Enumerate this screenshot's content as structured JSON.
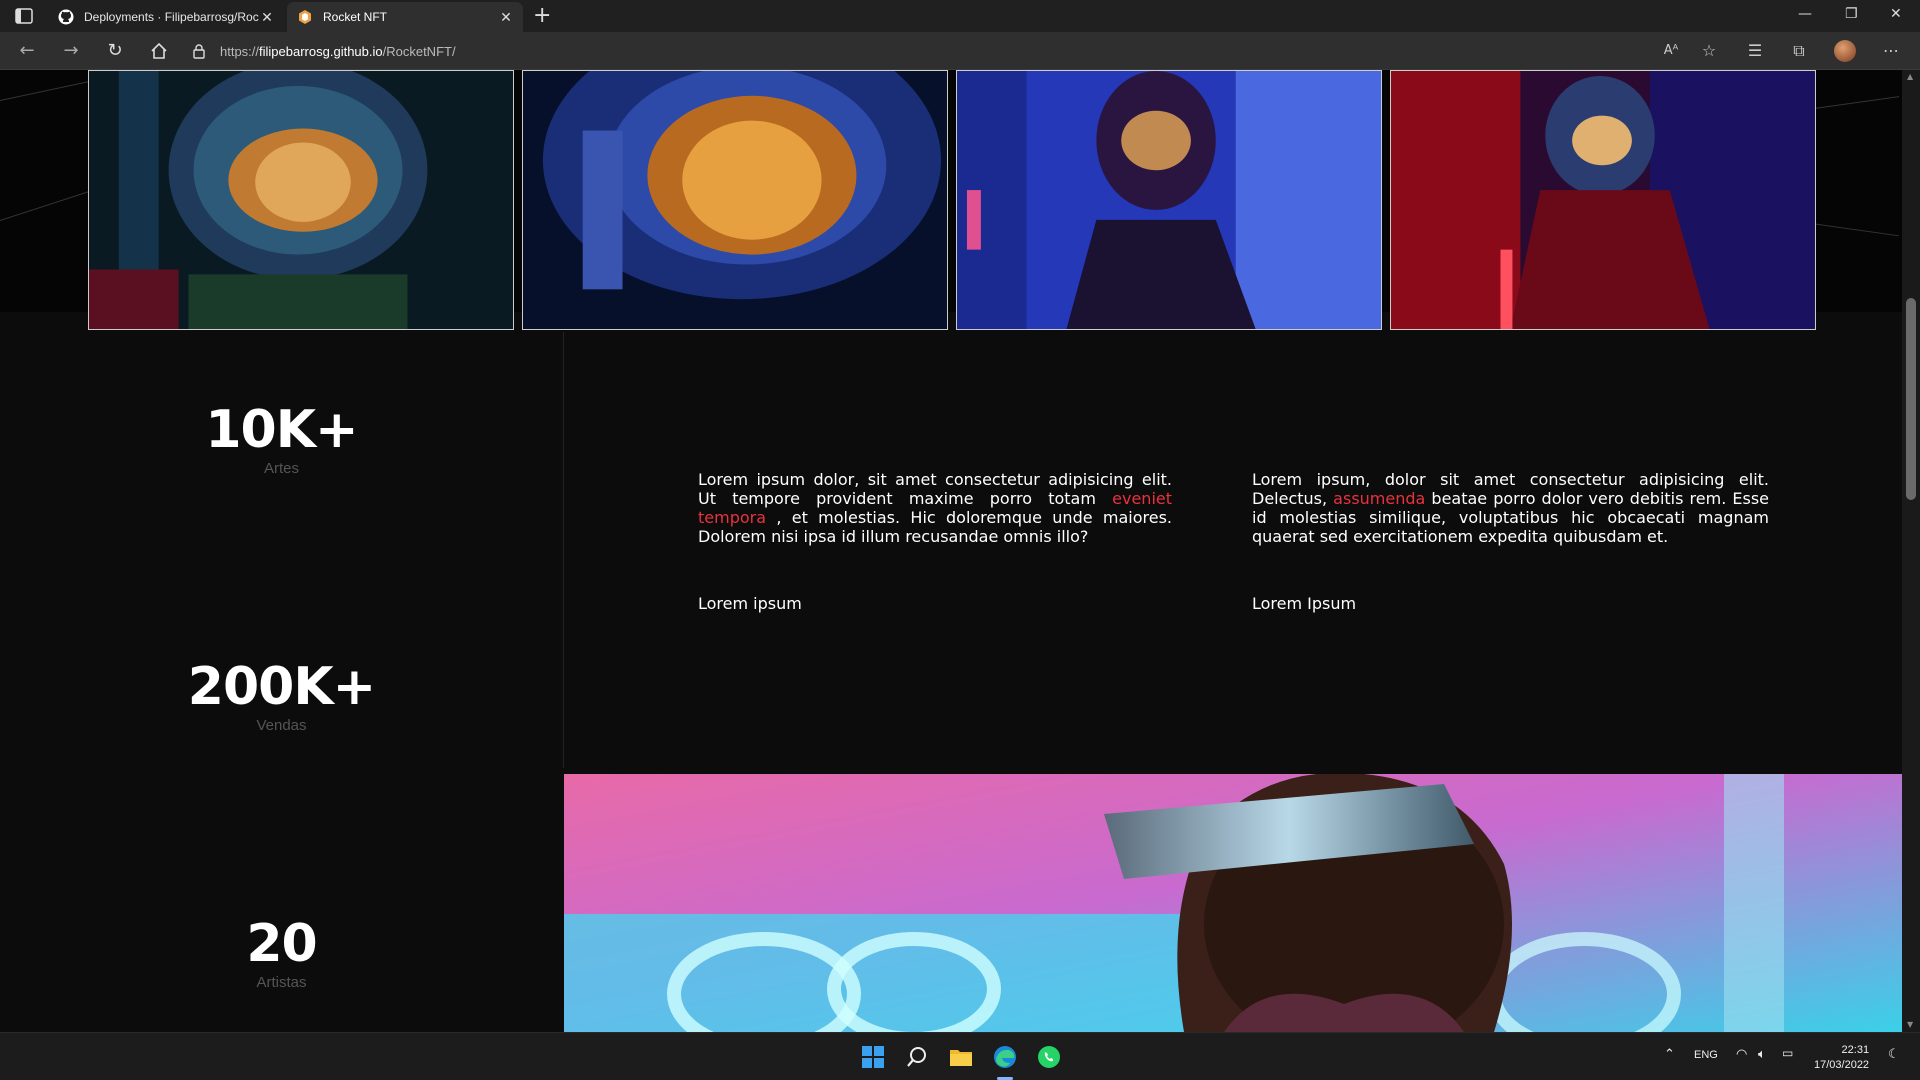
{
  "browser": {
    "tabs": [
      {
        "title": "Deployments · Filipebarrosg/Roc",
        "icon": "github-icon"
      },
      {
        "title": "Rocket NFT",
        "icon": "rocket-nft-favicon"
      }
    ],
    "address": {
      "scheme": "https://",
      "host": "filipebarrosg.github.io",
      "path": "/RocketNFT/"
    }
  },
  "gallery": {
    "photos": [
      {
        "alt": "astronaut-1"
      },
      {
        "alt": "astronaut-2"
      },
      {
        "alt": "astronaut-3"
      },
      {
        "alt": "astronaut-4"
      }
    ]
  },
  "stats": [
    {
      "value": "10K+",
      "label": "Artes"
    },
    {
      "value": "200K+",
      "label": "Vendas"
    },
    {
      "value": "20",
      "label": "Artistas"
    }
  ],
  "info": [
    {
      "text_before": "Lorem ipsum dolor, sit amet consectetur adipisicing elit. Ut tempore provident maxime porro totam ",
      "highlight": "eveniet tempora",
      "text_after": " , et molestias. Hic doloremque unde maiores. Dolorem nisi ipsa id illum recusandae omnis illo?",
      "title": "Lorem ipsum"
    },
    {
      "text_before": "Lorem ipsum, dolor sit amet consectetur adipisicing elit. Delectus, ",
      "highlight": "assumenda",
      "text_after": " beatae porro dolor vero debitis rem. Esse id molestias similique, voluptatibus hic obcaecati magnam quaerat sed exercitationem expedita quibusdam et.",
      "title": "Lorem Ipsum"
    }
  ],
  "colors": {
    "accent": "#e8323e",
    "background": "#0c0c0c"
  },
  "taskbar": {
    "apps": [
      "windows-start-icon",
      "search-icon",
      "file-explorer-icon",
      "edge-icon",
      "whatsapp-icon"
    ],
    "language": "ENG",
    "time": "22:31",
    "date": "17/03/2022"
  }
}
